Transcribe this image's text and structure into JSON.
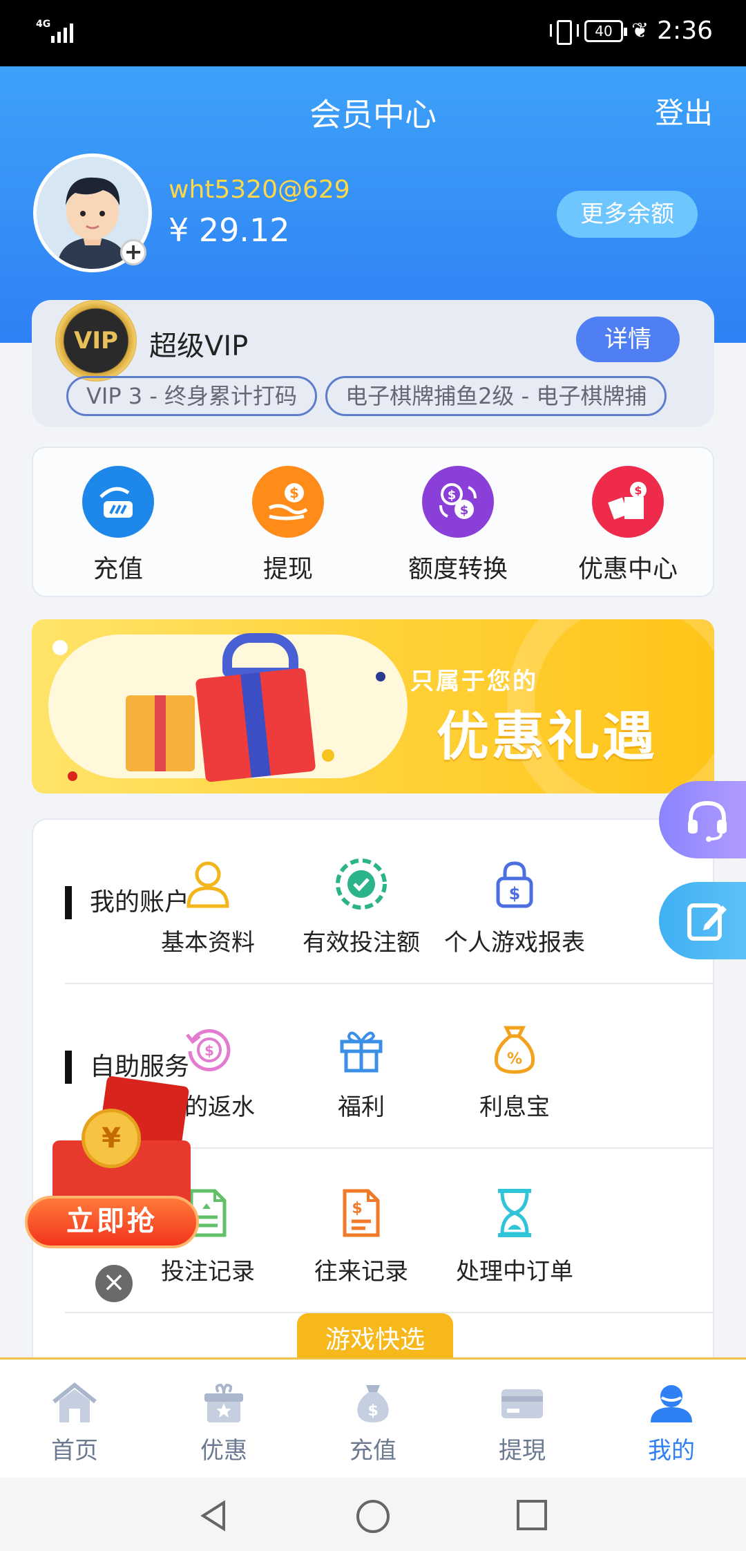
{
  "status_bar": {
    "network": "4G",
    "battery": "40",
    "time": "2:36"
  },
  "header": {
    "title": "会员中心",
    "logout": "登出",
    "username": "wht5320@629",
    "balance": "¥ 29.12",
    "more_balance": "更多余额"
  },
  "vip": {
    "badge": "VIP",
    "title": "超级VIP",
    "detail": "详情",
    "tags": [
      "VIP 3 - 终身累计打码",
      "电子棋牌捕鱼2级 - 电子棋牌捕"
    ]
  },
  "quick_actions": [
    {
      "label": "充值",
      "icon": "deposit-hand-card-icon",
      "color": "#1e88ea"
    },
    {
      "label": "提现",
      "icon": "withdraw-hand-coin-icon",
      "color": "#ff8b18"
    },
    {
      "label": "额度转换",
      "icon": "currency-exchange-icon",
      "color": "#8a3fd8"
    },
    {
      "label": "优惠中心",
      "icon": "gift-coupon-icon",
      "color": "#ee2b4a"
    }
  ],
  "banner": {
    "subtitle": "只属于您的",
    "title": "优惠礼遇"
  },
  "sections": [
    {
      "title": "我的账户",
      "items": [
        {
          "label": "基本资料",
          "icon": "user-profile-icon",
          "color": "#f2b51c"
        },
        {
          "label": "有效投注额",
          "icon": "chip-icon",
          "color": "#2bb48a"
        },
        {
          "label": "个人游戏报表",
          "icon": "lock-dollar-icon",
          "color": "#4b6fe0"
        }
      ]
    },
    {
      "title": "自助服务",
      "items": [
        {
          "label": "我的返水",
          "icon": "rebate-dollar-icon",
          "color": "#e37bd0"
        },
        {
          "label": "福利",
          "icon": "gift-box-icon",
          "color": "#3c8fe6"
        },
        {
          "label": "利息宝",
          "icon": "money-bag-percent-icon",
          "color": "#f2a21c"
        }
      ]
    },
    {
      "title": "",
      "items": [
        {
          "label": "投注记录",
          "icon": "bet-record-icon",
          "color": "#62c06a"
        },
        {
          "label": "往来记录",
          "icon": "transaction-record-icon",
          "color": "#f07a2a"
        },
        {
          "label": "处理中订单",
          "icon": "hourglass-icon",
          "color": "#2fc4d8"
        }
      ]
    }
  ],
  "quick_pick": "游戏快选",
  "red_packet": {
    "button": "立即抢",
    "coin": "¥"
  },
  "bottom_nav": [
    {
      "label": "首页",
      "icon": "home-icon",
      "active": false
    },
    {
      "label": "优惠",
      "icon": "gift-icon",
      "active": false
    },
    {
      "label": "充值",
      "icon": "money-bag-icon",
      "active": false
    },
    {
      "label": "提現",
      "icon": "card-icon",
      "active": false
    },
    {
      "label": "我的",
      "icon": "user-icon",
      "active": true
    }
  ],
  "colors": {
    "primary": "#2f80f5",
    "accent": "#ffd84a",
    "nav_inactive": "#6b7a90"
  }
}
